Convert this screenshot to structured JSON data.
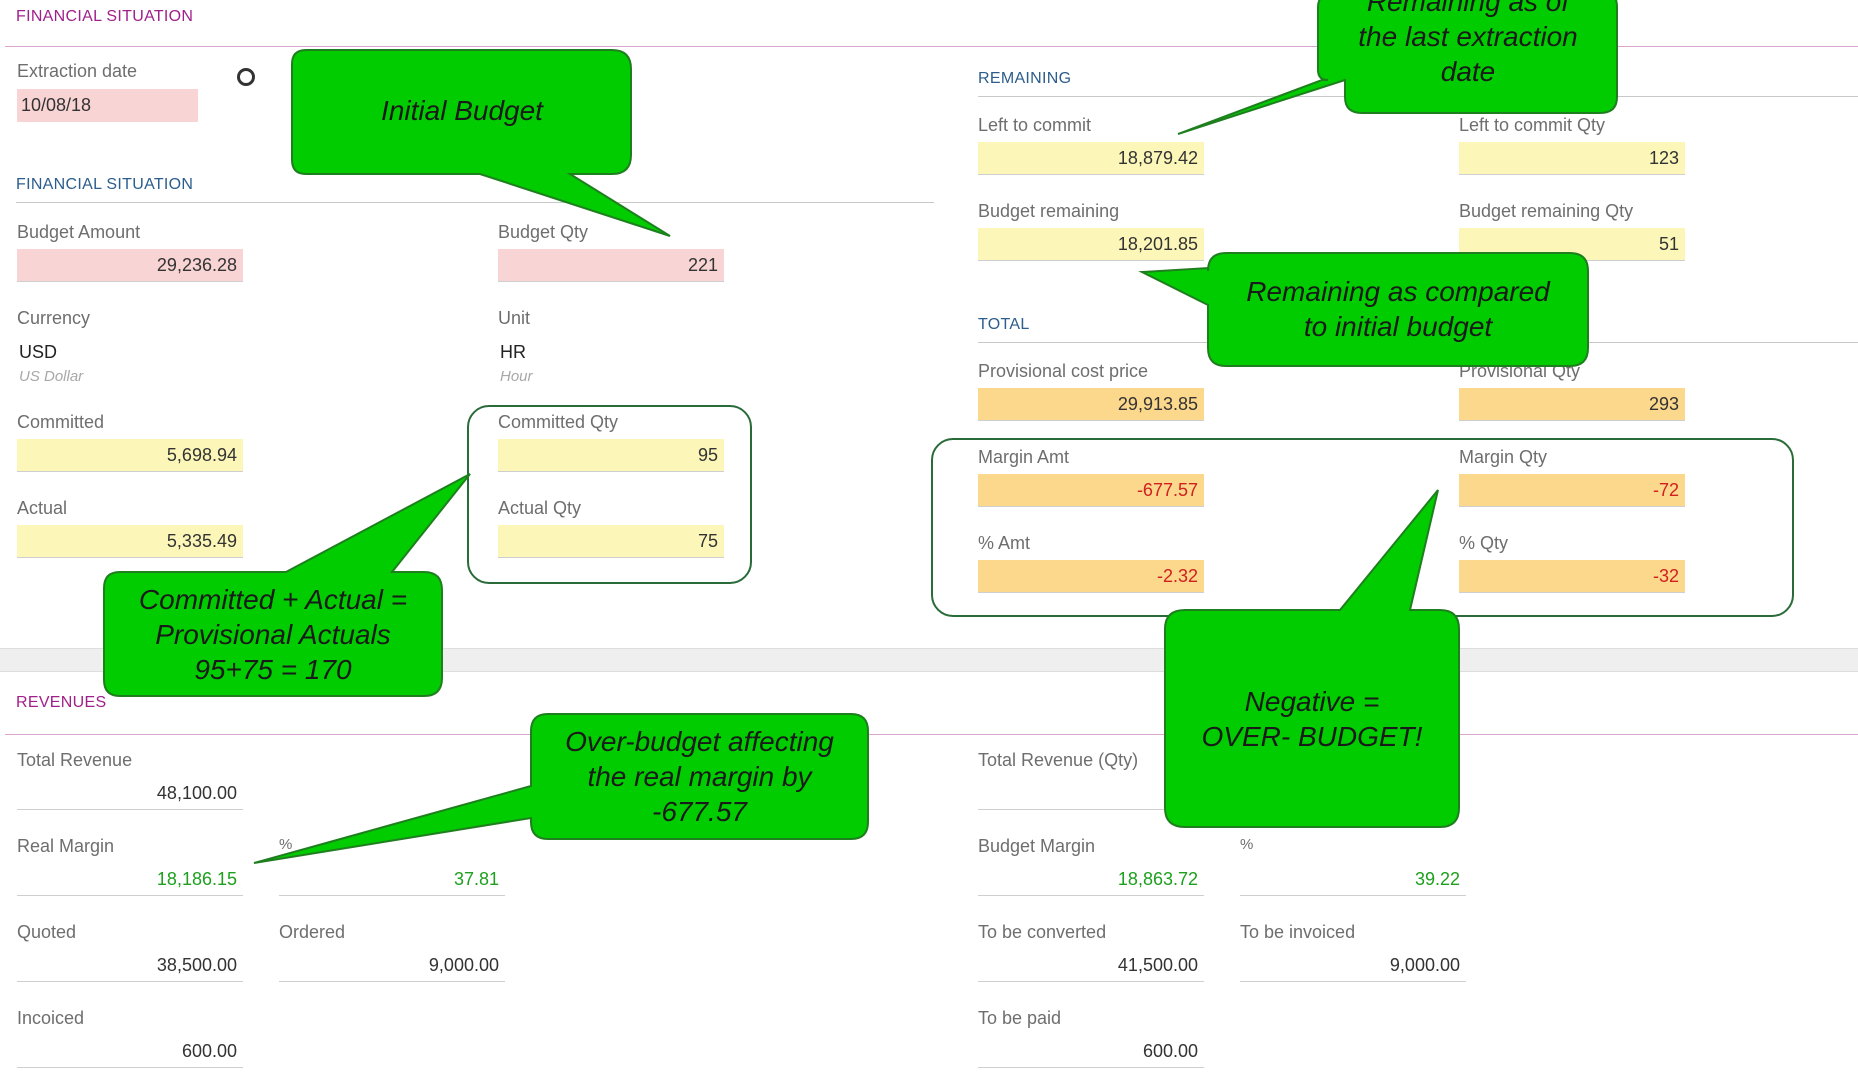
{
  "top_section_title": "FINANCIAL SITUATION",
  "extraction": {
    "label": "Extraction date",
    "value": "10/08/18"
  },
  "financial": {
    "title": "FINANCIAL SITUATION",
    "budget_amount": {
      "label": "Budget Amount",
      "value": "29,236.28"
    },
    "budget_qty": {
      "label": "Budget Qty",
      "value": "221"
    },
    "currency": {
      "label": "Currency",
      "value": "USD",
      "sub": "US Dollar"
    },
    "unit": {
      "label": "Unit",
      "value": "HR",
      "sub": "Hour"
    },
    "committed": {
      "label": "Committed",
      "value": "5,698.94"
    },
    "committed_qty": {
      "label": "Committed Qty",
      "value": "95"
    },
    "actual": {
      "label": "Actual",
      "value": "5,335.49"
    },
    "actual_qty": {
      "label": "Actual Qty",
      "value": "75"
    }
  },
  "remaining": {
    "title": "REMAINING",
    "left_to_commit": {
      "label": "Left to commit",
      "value": "18,879.42"
    },
    "left_to_commit_qty": {
      "label": "Left to commit Qty",
      "value": "123"
    },
    "budget_remaining": {
      "label": "Budget remaining",
      "value": "18,201.85"
    },
    "budget_remaining_qty": {
      "label": "Budget remaining Qty",
      "value": "51"
    }
  },
  "total": {
    "title": "TOTAL",
    "provisional_cost": {
      "label": "Provisional cost price",
      "value": "29,913.85"
    },
    "provisional_qty": {
      "label": "Provisional Qty",
      "value": "293"
    },
    "margin_amt": {
      "label": "Margin Amt",
      "value": "-677.57"
    },
    "margin_qty": {
      "label": "Margin Qty",
      "value": "-72"
    },
    "pct_amt": {
      "label": "% Amt",
      "value": "-2.32"
    },
    "pct_qty": {
      "label": "% Qty",
      "value": "-32"
    }
  },
  "revenues": {
    "title": "REVENUES",
    "total_revenue": {
      "label": "Total Revenue",
      "value": "48,100.00"
    },
    "total_revenue_qty": {
      "label": "Total Revenue (Qty)",
      "value": ""
    },
    "real_margin": {
      "label": "Real Margin",
      "value": "18,186.15"
    },
    "real_margin_pct": {
      "label": "%",
      "value": "37.81"
    },
    "budget_margin": {
      "label": "Budget Margin",
      "value": "18,863.72"
    },
    "budget_margin_pct": {
      "label": "%",
      "value": "39.22"
    },
    "quoted": {
      "label": "Quoted",
      "value": "38,500.00"
    },
    "ordered": {
      "label": "Ordered",
      "value": "9,000.00"
    },
    "to_be_converted": {
      "label": "To be converted",
      "value": "41,500.00"
    },
    "to_be_invoiced": {
      "label": "To be invoiced",
      "value": "9,000.00"
    },
    "incoiced": {
      "label": "Incoiced",
      "value": "600.00"
    },
    "to_be_paid": {
      "label": "To be paid",
      "value": "600.00"
    }
  },
  "callouts": {
    "initial_budget": [
      "Initial Budget"
    ],
    "remaining_as_of": [
      "Remaining as of",
      "the last extraction",
      "date"
    ],
    "remaining_compared": [
      "Remaining as compared",
      "to initial budget"
    ],
    "committed_actual": [
      "Committed + Actual =",
      "Provisional Actuals",
      "95+75 = 170"
    ],
    "negative": [
      "Negative =",
      "OVER- BUDGET!"
    ],
    "over_budget": [
      "Over-budget affecting",
      "the real margin by",
      "-677.57"
    ]
  },
  "colors": {
    "callout_fill": "#00cc00",
    "callout_stroke": "#1f7f1f",
    "pink_field": "#f9d4d4",
    "yellow_field": "#fcf7b9",
    "orange_field": "#fbd88c",
    "negative_text": "#d02020",
    "positive_text": "#1ea01e"
  }
}
